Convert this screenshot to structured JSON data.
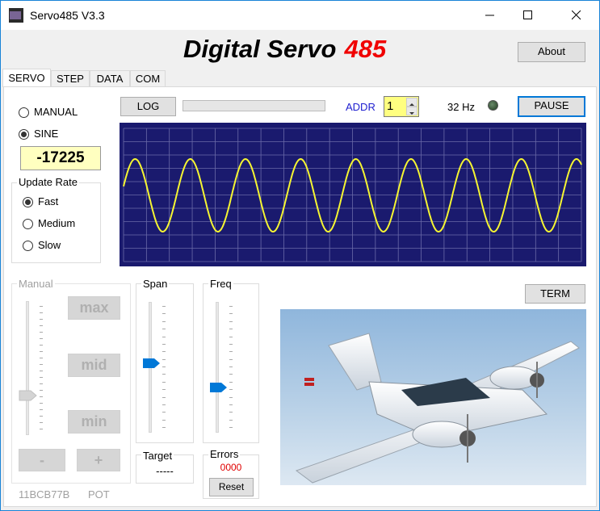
{
  "window": {
    "title": "Servo485 V3.3"
  },
  "header": {
    "title": "Digital Servo",
    "number": "485",
    "about_label": "About"
  },
  "tabs": [
    "SERVO",
    "STEP",
    "DATA",
    "COM"
  ],
  "mode": {
    "options": [
      {
        "label": "MANUAL",
        "selected": false
      },
      {
        "label": "SINE",
        "selected": true
      }
    ],
    "value": "-17225"
  },
  "update_rate": {
    "label": "Update Rate",
    "options": [
      {
        "label": "Fast",
        "selected": true
      },
      {
        "label": "Medium",
        "selected": false
      },
      {
        "label": "Slow",
        "selected": false
      }
    ]
  },
  "toolbar": {
    "log_label": "LOG",
    "addr_label": "ADDR",
    "addr_value": "1",
    "rate_text": "32 Hz",
    "pause_label": "PAUSE"
  },
  "manual": {
    "label": "Manual",
    "max_label": "max",
    "mid_label": "mid",
    "min_label": "min",
    "minus_label": "-",
    "plus_label": "+",
    "slider_level": 0.27
  },
  "span": {
    "label": "Span",
    "slider_level": 0.53
  },
  "freq": {
    "label": "Freq",
    "slider_level": 0.33
  },
  "target": {
    "label": "Target",
    "value": "-----"
  },
  "errors": {
    "label": "Errors",
    "value": "0000",
    "reset_label": "Reset"
  },
  "term_label": "TERM",
  "footer": {
    "id": "11BCB77B",
    "pot": "POT"
  },
  "colors": {
    "scope_bg": "#1a1a6e",
    "trace": "#f5f532",
    "grid": "#6a6aa8",
    "addr": "#2020d0",
    "error": "#e00000",
    "slider_thumb": "#0078d7"
  },
  "chart_data": {
    "type": "line",
    "series": [
      {
        "shape": "sine",
        "cycles": 8.3
      }
    ]
  }
}
